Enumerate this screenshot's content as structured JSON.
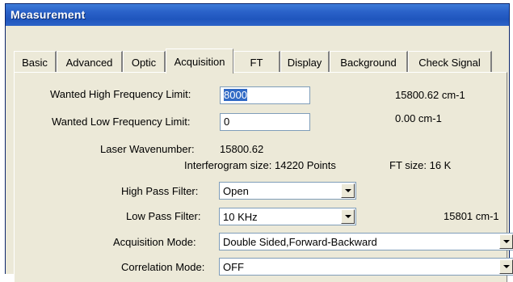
{
  "window": {
    "title": "Measurement"
  },
  "tabs": [
    "Basic",
    "Advanced",
    "Optic",
    "Acquisition",
    "FT",
    "Display",
    "Background",
    "Check Signal"
  ],
  "active_tab": "Acquisition",
  "form": {
    "high_freq_label": "Wanted High Frequency Limit:",
    "high_freq_value": "8000",
    "high_freq_info": "15800.62 cm-1",
    "low_freq_label": "Wanted Low Frequency Limit:",
    "low_freq_value": "0",
    "low_freq_info": "0.00 cm-1",
    "laser_label": "Laser Wavenumber:",
    "laser_value": "15800.62",
    "interferogram_text": "Interferogram size: 14220 Points",
    "ft_size_text": "FT size: 16 K",
    "high_pass_label": "High Pass Filter:",
    "high_pass_value": "Open",
    "low_pass_label": "Low Pass Filter:",
    "low_pass_value": "10 KHz",
    "low_pass_info": "15801 cm-1",
    "acq_mode_label": "Acquisition Mode:",
    "acq_mode_value": "Double Sided,Forward-Backward",
    "corr_mode_label": "Correlation Mode:",
    "corr_mode_value": "OFF"
  }
}
